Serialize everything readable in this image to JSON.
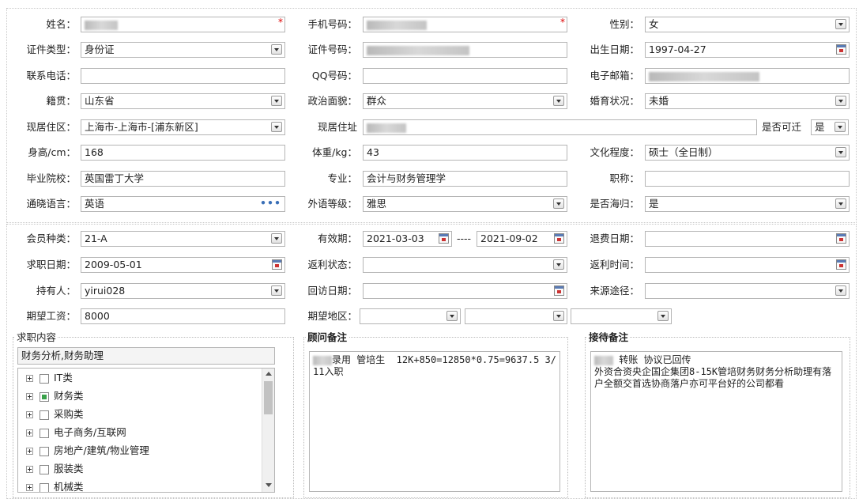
{
  "form1": {
    "row1": {
      "name_label": "姓名：",
      "phone_label": "手机号码：",
      "gender_label": "性别：",
      "gender_value": "女"
    },
    "row2": {
      "idtype_label": "证件类型：",
      "idtype_value": "身份证",
      "idno_label": "证件号码：",
      "birth_label": "出生日期：",
      "birth_value": "1997-04-27"
    },
    "row3": {
      "tel_label": "联系电话：",
      "qq_label": "QQ号码：",
      "email_label": "电子邮箱："
    },
    "row4": {
      "native_label": "籍贯：",
      "native_value": "山东省",
      "political_label": "政治面貌：",
      "political_value": "群众",
      "marital_label": "婚育状况：",
      "marital_value": "未婚"
    },
    "row5": {
      "residence_label": "现居住区：",
      "residence_value": "上海市-上海市-[浦东新区]",
      "address_label": "现居住址",
      "relocate_label": "是否可迁",
      "relocate_value": "是"
    },
    "row6": {
      "height_label": "身高/cm：",
      "height_value": "168",
      "weight_label": "体重/kg：",
      "weight_value": "43",
      "edu_label": "文化程度：",
      "edu_value": "硕士（全日制）"
    },
    "row7": {
      "school_label": "毕业院校：",
      "school_value": "英国雷丁大学",
      "major_label": "专业：",
      "major_value": "会计与财务管理学",
      "title_label": "职称："
    },
    "row8": {
      "lang_label": "通晓语言：",
      "lang_value": "英语",
      "langlevel_label": "外语等级：",
      "langlevel_value": "雅思",
      "returnee_label": "是否海归：",
      "returnee_value": "是"
    }
  },
  "form2": {
    "row1": {
      "member_label": "会员种类：",
      "member_value": "21-A",
      "valid_label": "有效期：",
      "valid_from": "2021-03-03",
      "valid_sep": "----",
      "valid_to": "2021-09-02",
      "refund_label": "退费日期："
    },
    "row2": {
      "jobdate_label": "求职日期：",
      "jobdate_value": "2009-05-01",
      "rebate_status_label": "返利状态：",
      "rebate_time_label": "返利时间："
    },
    "row3": {
      "holder_label": "持有人：",
      "holder_value": "yirui028",
      "revisit_label": "回访日期：",
      "source_label": "来源途径："
    },
    "row4": {
      "salary_label": "期望工资：",
      "salary_value": "8000",
      "region_label": "期望地区："
    }
  },
  "job_content": {
    "title": "求职内容",
    "summary": "财务分析,财务助理",
    "tree": [
      {
        "label": "IT类",
        "checked": "none"
      },
      {
        "label": "财务类",
        "checked": "partial"
      },
      {
        "label": "采购类",
        "checked": "none"
      },
      {
        "label": "电子商务/互联网",
        "checked": "none"
      },
      {
        "label": "房地产/建筑/物业管理",
        "checked": "none"
      },
      {
        "label": "服装类",
        "checked": "none"
      },
      {
        "label": "机械类",
        "checked": "none"
      }
    ]
  },
  "advisor_note": {
    "title": "顾问备注",
    "text": "录用 管培生  12K+850=12850*0.75=9637.5 3/11入职"
  },
  "reception_note": {
    "title": "接待备注",
    "text": " 转账 协议已回传\n外资合资央企国企集团8-15K管培财务财务分析助理有落户全额交首选协商落户亦可平台好的公司都看"
  }
}
